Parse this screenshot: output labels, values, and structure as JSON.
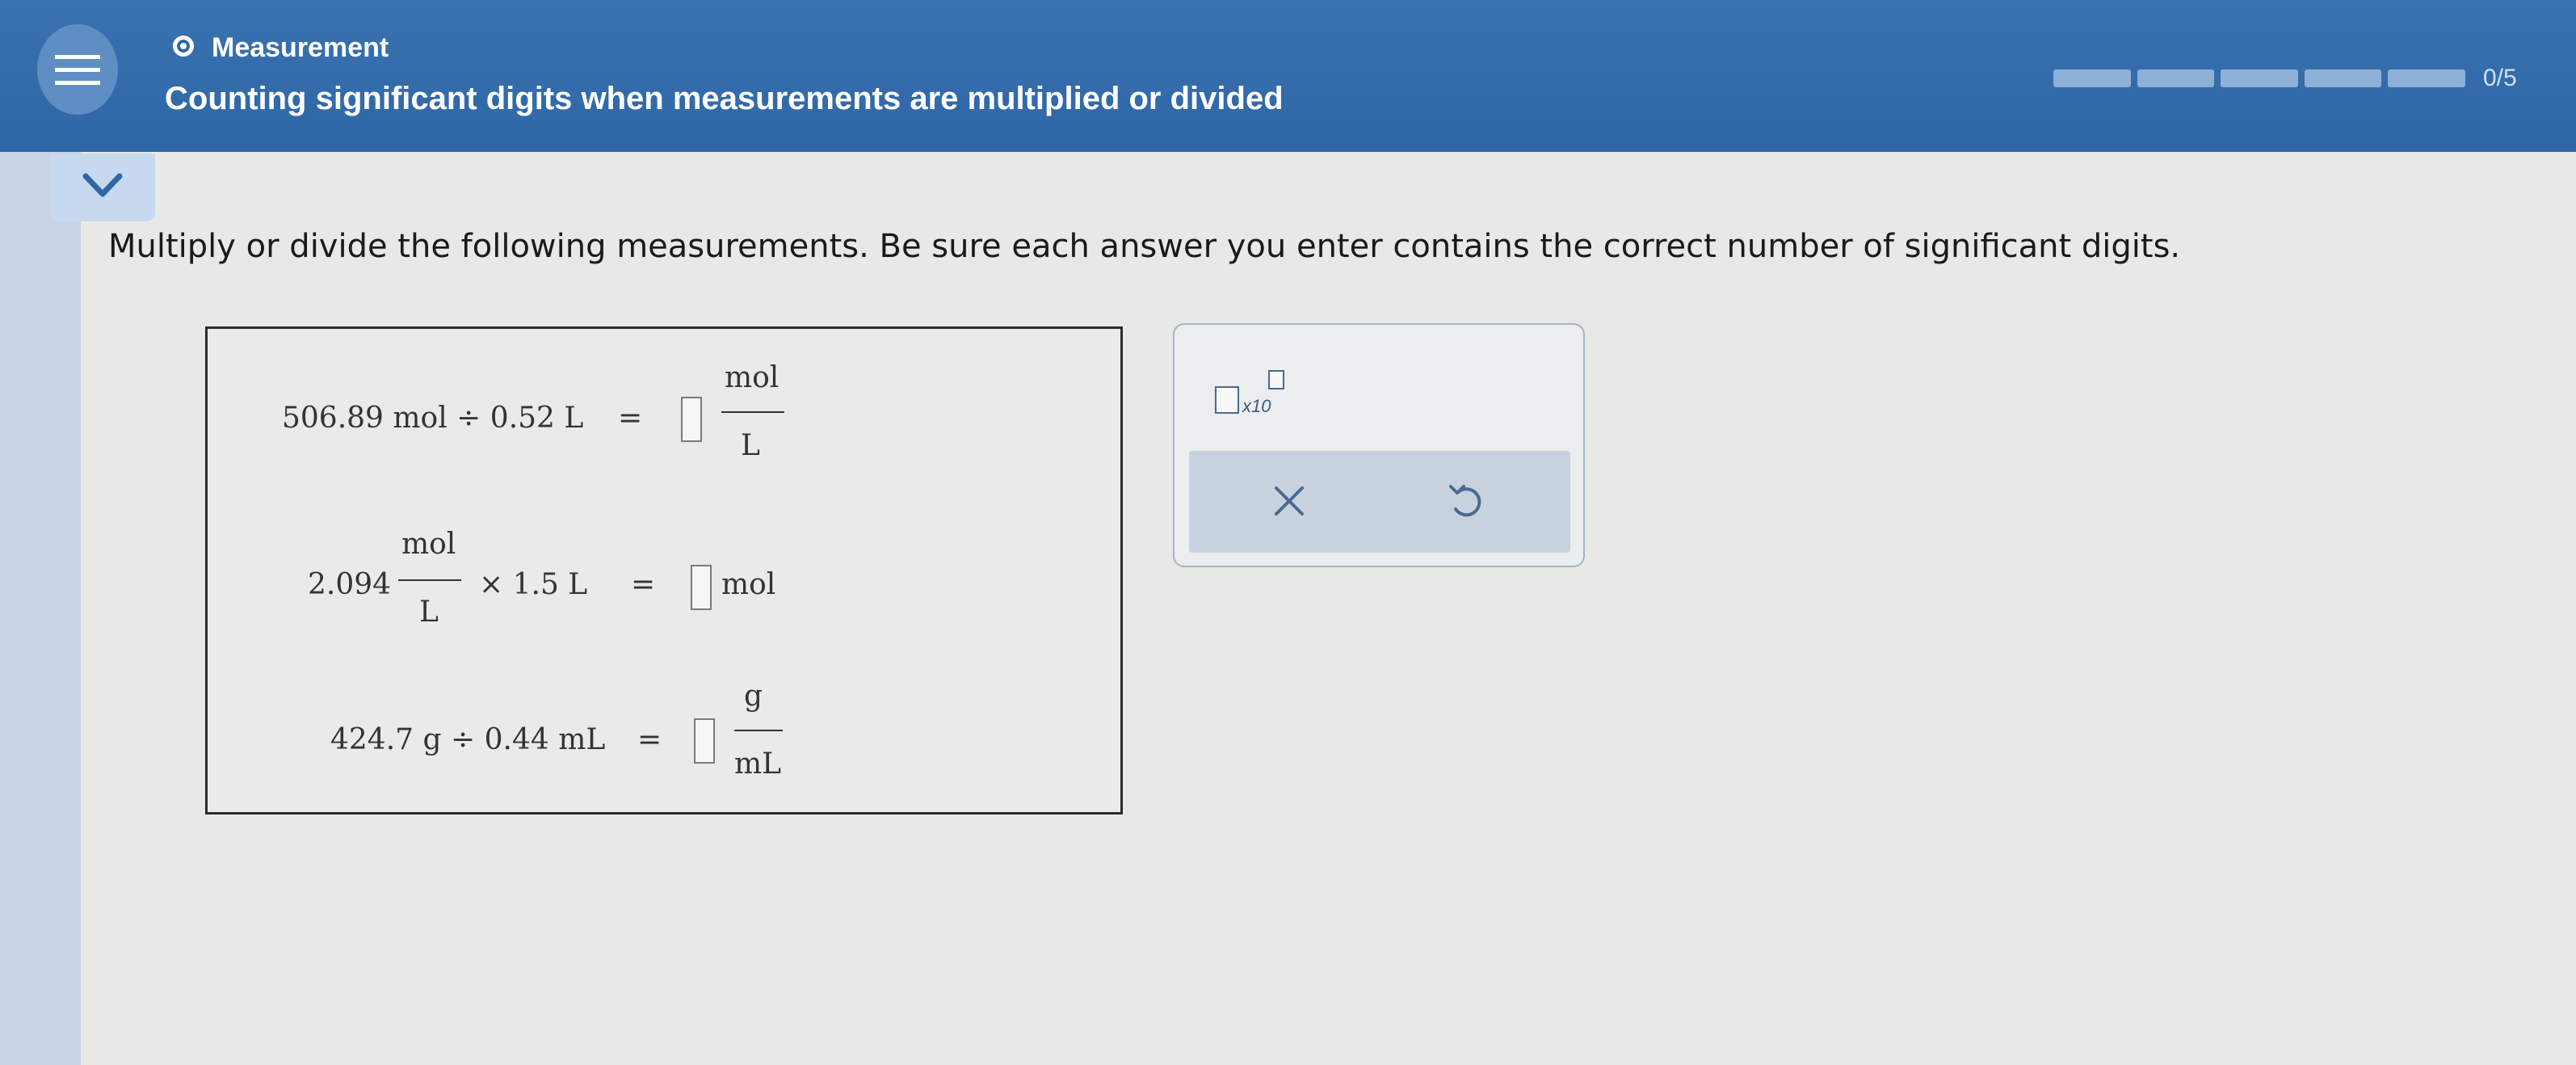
{
  "header": {
    "topic": "Measurement",
    "title": "Counting significant digits when measurements are multiplied or divided",
    "progress": {
      "text": "0/5",
      "completed": 0,
      "total": 5
    }
  },
  "instruction": "Multiply or divide the following measurements. Be sure each answer you enter contains the correct number of significant digits.",
  "problems": [
    {
      "expression": "506.89 mol ÷ 0.52 L",
      "equals": "=",
      "unit_num": "mol",
      "unit_den": "L"
    },
    {
      "coef": "2.094",
      "coef_num": "mol",
      "coef_den": "L",
      "rest": "× 1.5 L",
      "equals": "=",
      "unit": "mol"
    },
    {
      "expression": "424.7 g ÷ 0.44 mL",
      "equals": "=",
      "unit_num": "g",
      "unit_den": "mL"
    }
  ],
  "tools": {
    "sci_label": "x10",
    "clear_icon": "x-icon",
    "undo_icon": "undo-icon"
  },
  "colors": {
    "header": "#2f66a6",
    "panel_bar": "#c8d2df",
    "icon": "#4a6a92"
  }
}
